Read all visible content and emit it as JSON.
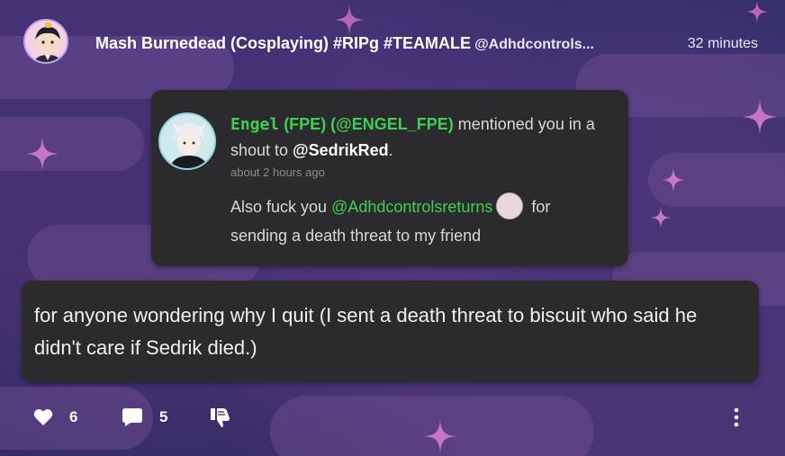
{
  "post": {
    "author_name": "Mash Burnedead (Cosplaying) #RIPg #TEAMALE",
    "author_handle": "@Adhdcontrols...",
    "time": "32 minutes",
    "text": "for anyone wondering why I quit (I sent a death threat to biscuit who said he didn't care if Sedrik died.)"
  },
  "quote": {
    "name": "Engel",
    "name_suffix": " (FPE) (@ENGEL_FPE)",
    "action": " mentioned you in a shout to ",
    "mention": "@SedrikRed",
    "period": ".",
    "ago": "about 2 hours ago",
    "body_before": "Also fuck you ",
    "body_mention": "@Adhdcontrolsreturns",
    "body_after": " for sending a death threat to my friend"
  },
  "actions": {
    "likes": "6",
    "comments": "5"
  },
  "colors": {
    "accent_green": "#3ecf53",
    "card": "#2b2a2c",
    "star": "#c776c6"
  },
  "icons": [
    "heart-icon",
    "comment-icon",
    "thumbs-down-icon",
    "more-vertical-icon",
    "star-icon"
  ]
}
